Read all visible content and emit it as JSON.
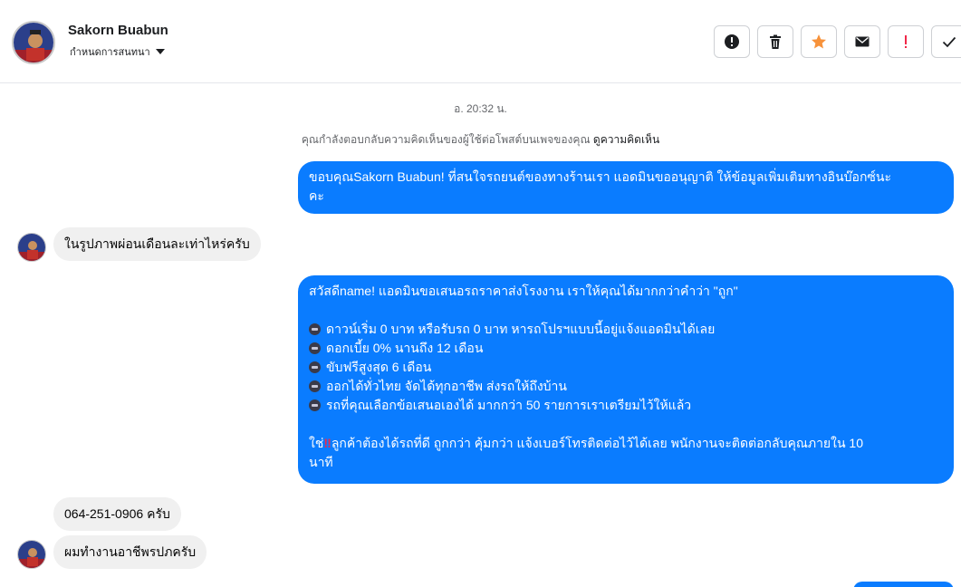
{
  "header": {
    "contact_name": "Sakorn Buabun",
    "assign_label": "กำหนดการสนทนา",
    "actions": [
      {
        "name": "report-icon"
      },
      {
        "name": "trash-icon"
      },
      {
        "name": "star-icon"
      },
      {
        "name": "mail-icon"
      },
      {
        "name": "exclamation-icon"
      },
      {
        "name": "checkmark-icon"
      }
    ]
  },
  "thread": {
    "timestamp": "อ. 20:32 น.",
    "notice_text": "คุณกำลังตอบกลับความคิดเห็นของผู้ใช้ต่อโพสต์บนเพจของคุณ",
    "notice_link": "ดูความคิดเห็น",
    "messages": [
      {
        "from": "page",
        "lines": [
          "ขอบคุณSakorn Buabun! ที่สนใจรถยนต์ของทางร้านเรา แอดมินขออนุญาติ ให้ข้อมูลเพิ่มเติมทางอินบ๊อกซ์นะ",
          "คะ"
        ]
      },
      {
        "from": "user",
        "text": "ในรูปภาพผ่อนเดือนละเท่าไหร่ครับ"
      },
      {
        "from": "page",
        "intro": "สวัสดีname! แอดมินขอเสนอรถราคาส่งโรงงาน เราให้คุณได้มากกว่าคำว่า \"ถูก\"",
        "bullets": [
          "ดาวน์เริ่ม 0 บาท หรือรับรถ 0 บาท หารถโปรฯแบบนี้อยู่แจ้งแอดมินได้เลย",
          "ดอกเบี้ย 0% นานถึง 12 เดือน",
          "ขับฟรีสูงสุด 6 เดือน",
          "ออกได้ทั่วไทย จัดได้ทุกอาชีพ ส่งรถให้ถึงบ้าน",
          "รถที่คุณเลือกข้อเสนอเองได้ มากกว่า 50 รายการเราเตรียมไว้ให้แล้ว"
        ],
        "closing_prefix": "ใช่",
        "closing_mark": "‼",
        "closing_line1": "ลูกค้าต้องได้รถที่ดี ถูกกว่า คุ้มกว่า แจ้งเบอร์โทรติดต่อไว้ได้เลย พนักงานจะติดต่อกลับคุณภายใน 10",
        "closing_line2": "นาที"
      },
      {
        "from": "user",
        "text": "064-251-0906 ครับ"
      },
      {
        "from": "user",
        "text": "ผมทำงานอาชีพรปภครับ"
      }
    ]
  },
  "colors": {
    "outgoing_bubble": "#0a7cff",
    "incoming_bubble": "#f0f0f0",
    "star": "#f7923a",
    "alert": "#f02849"
  }
}
